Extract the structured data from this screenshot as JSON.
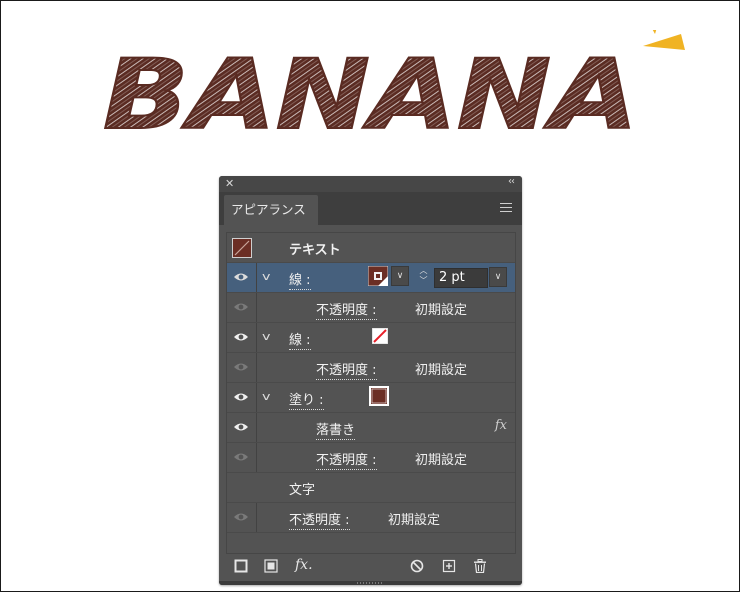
{
  "artwork": {
    "title": "BANANA",
    "fill_color": "#5a2b22",
    "accent_color": "#f0b323"
  },
  "panel": {
    "tab_label": "アピアランス",
    "rows": [
      {
        "label": "テキスト"
      },
      {
        "label": "線 :",
        "stroke_weight": "2 pt"
      },
      {
        "label": "不透明度 :",
        "value": "初期設定"
      },
      {
        "label": "線 :"
      },
      {
        "label": "不透明度 :",
        "value": "初期設定"
      },
      {
        "label": "塗り :"
      },
      {
        "label": "落書き",
        "effect_icon": "fx"
      },
      {
        "label": "不透明度 :",
        "value": "初期設定"
      },
      {
        "label": "文字"
      },
      {
        "label": "不透明度 :",
        "value": "初期設定"
      }
    ],
    "footer_fx": "fx."
  },
  "colors": {
    "panel_bg": "#535353",
    "selected_row": "#46607d",
    "swatch_brown": "#6b2e24",
    "none_red": "#e8202a"
  }
}
